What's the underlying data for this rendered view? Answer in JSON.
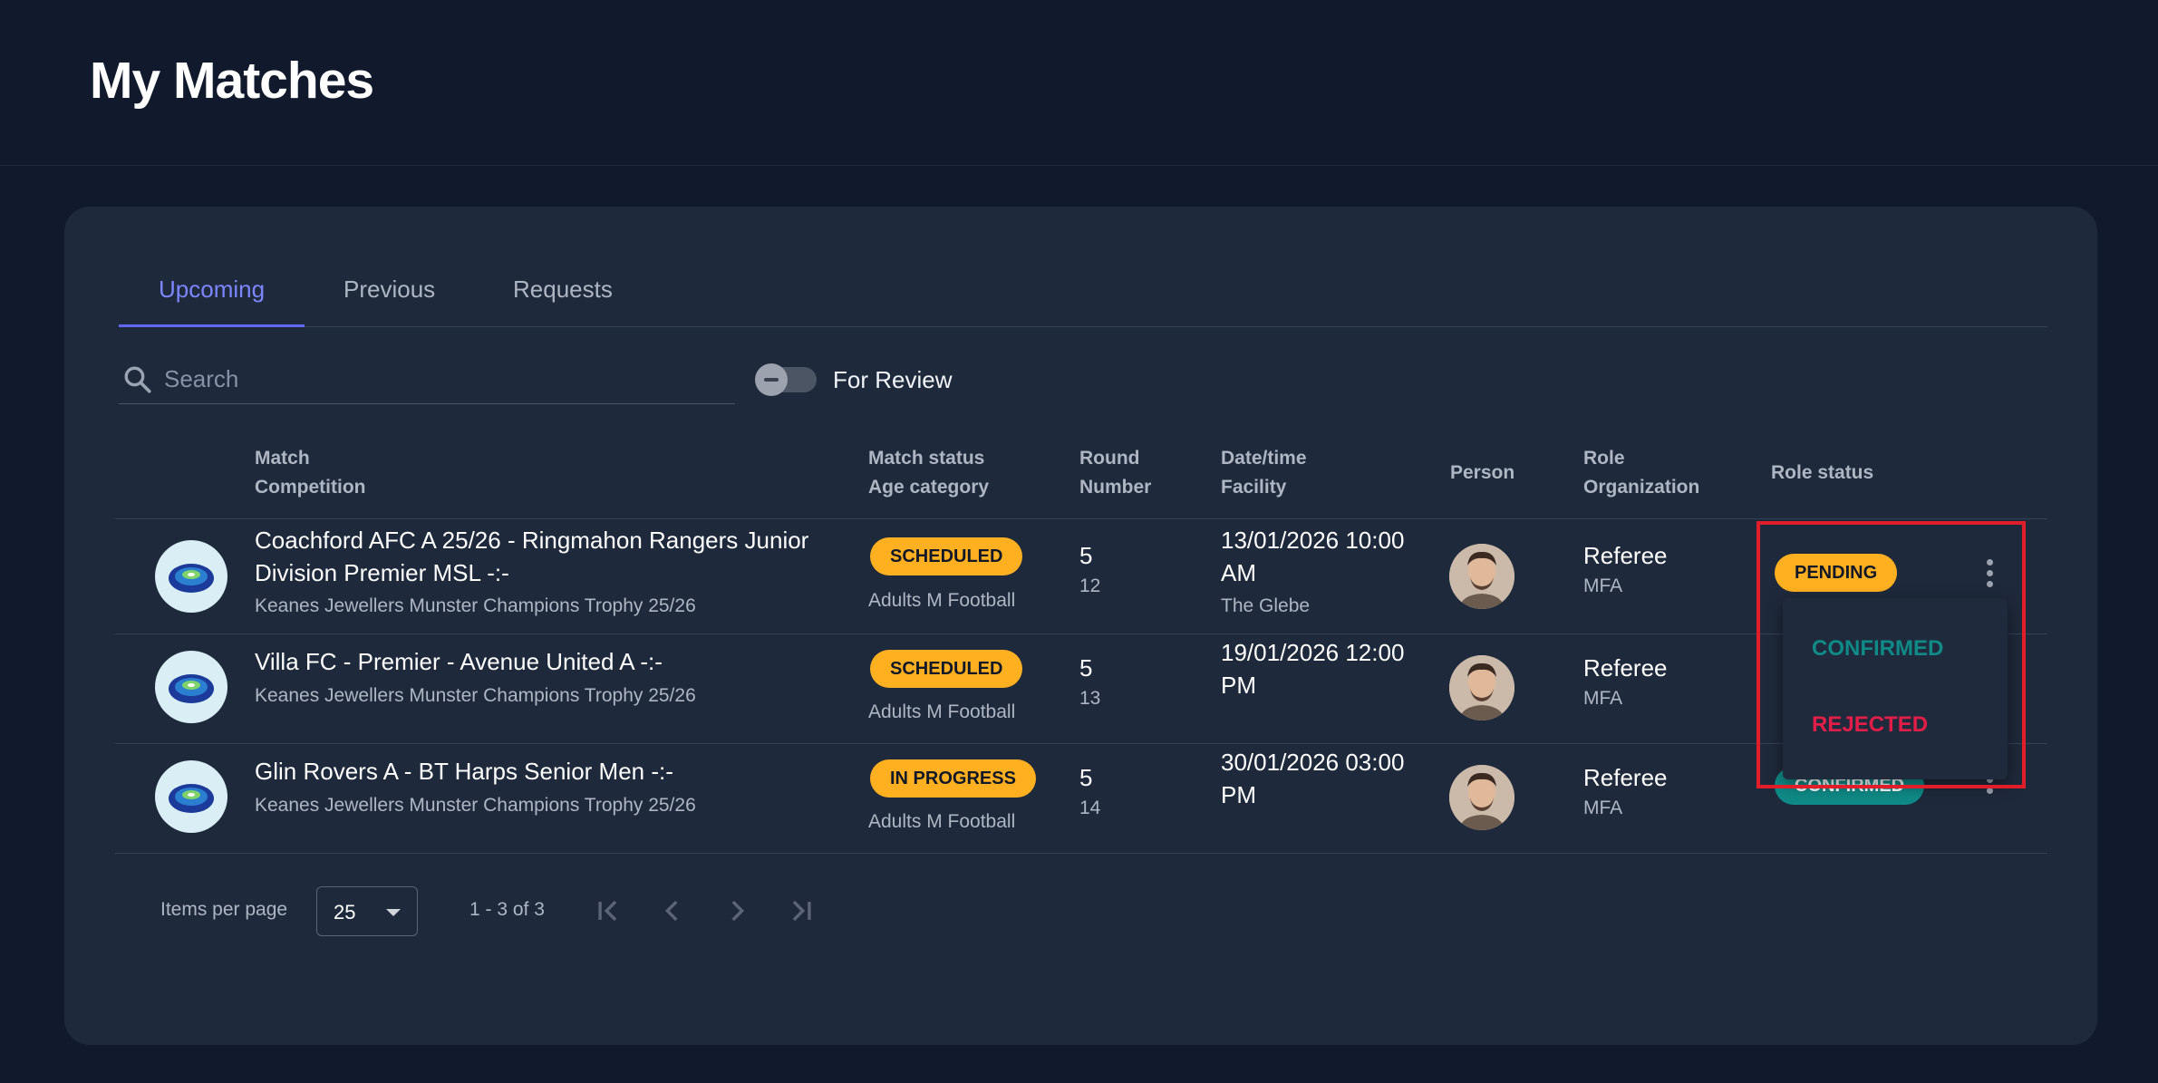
{
  "page": {
    "title": "My Matches"
  },
  "tabs": [
    {
      "label": "Upcoming",
      "active": true
    },
    {
      "label": "Previous",
      "active": false
    },
    {
      "label": "Requests",
      "active": false
    }
  ],
  "search": {
    "placeholder": "Search",
    "value": "",
    "icon": "search-icon"
  },
  "filter": {
    "label": "For Review",
    "enabled": false
  },
  "table": {
    "headers": {
      "match": "Match",
      "competition": "Competition",
      "match_status": "Match status",
      "age_category": "Age category",
      "round": "Round",
      "number": "Number",
      "datetime": "Date/time",
      "facility": "Facility",
      "person": "Person",
      "role": "Role",
      "organization": "Organization",
      "role_status": "Role status"
    },
    "rows": [
      {
        "match": "Coachford AFC A 25/26 - Ringmahon Rangers Junior Division Premier MSL -:-",
        "competition": "Keanes Jewellers Munster Champions Trophy 25/26",
        "match_status": "SCHEDULED",
        "age_category": "Adults M Football",
        "round": "5",
        "number": "12",
        "datetime": "13/01/2026 10:00 AM",
        "facility": "The Glebe",
        "role": "Referee",
        "organization": "MFA",
        "role_status": "PENDING"
      },
      {
        "match": "Villa FC - Premier - Avenue United A -:-",
        "competition": "Keanes Jewellers Munster Champions Trophy 25/26",
        "match_status": "SCHEDULED",
        "age_category": "Adults M Football",
        "round": "5",
        "number": "13",
        "datetime": "19/01/2026 12:00 PM",
        "facility": "",
        "role": "Referee",
        "organization": "MFA",
        "role_status": ""
      },
      {
        "match": "Glin Rovers A - BT Harps Senior Men -:-",
        "competition": "Keanes Jewellers Munster Champions Trophy 25/26",
        "match_status": "IN PROGRESS",
        "age_category": "Adults M Football",
        "round": "5",
        "number": "14",
        "datetime": "30/01/2026 03:00 PM",
        "facility": "",
        "role": "Referee",
        "organization": "MFA",
        "role_status": "CONFIRMED"
      }
    ]
  },
  "status_menu": {
    "items": [
      {
        "label": "CONFIRMED",
        "color": "#0f8a86"
      },
      {
        "label": "REJECTED",
        "color": "#e11d48"
      }
    ]
  },
  "pagination": {
    "items_per_page_label": "Items per page",
    "items_per_page": "25",
    "range": "1 - 3 of 3"
  },
  "colors": {
    "background": "#111a2c",
    "card": "#1e293b",
    "accent": "#6366f1",
    "scheduled": "#ffb020",
    "confirmed": "#0f8a86",
    "rejected": "#e11d48",
    "highlight": "#e11d2a"
  }
}
